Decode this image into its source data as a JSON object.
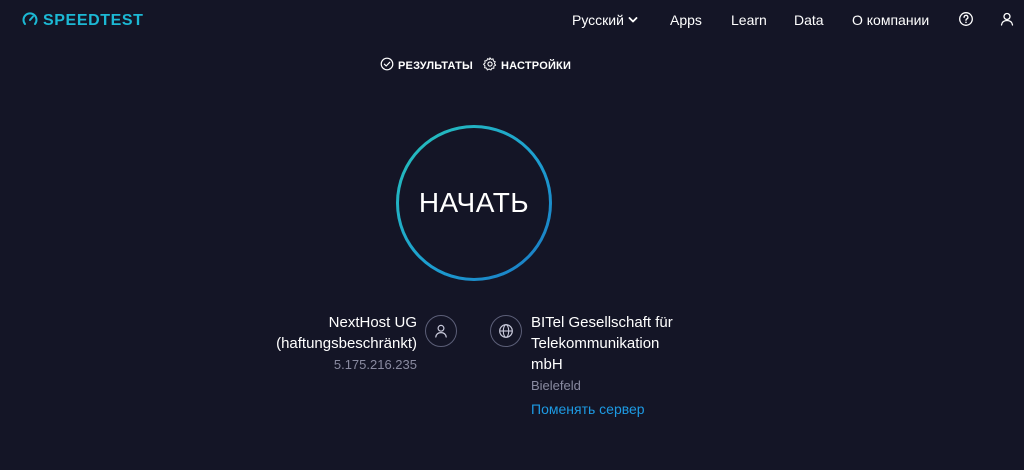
{
  "header": {
    "logo_text": "SPEEDTEST",
    "nav": {
      "language": "Русский",
      "apps": "Apps",
      "learn": "Learn",
      "data": "Data",
      "about": "О компании"
    }
  },
  "subnav": {
    "results": "РЕЗУЛЬТАТЫ",
    "settings": "НАСТРОЙКИ"
  },
  "start_button": "НАЧАТЬ",
  "isp": {
    "name_line1": "NextHost UG",
    "name_line2": "(haftungsbeschränkt)",
    "ip": "5.175.216.235"
  },
  "server": {
    "name_line1": "BITel Gesellschaft für",
    "name_line2": "Telekommunikation",
    "name_line3": "mbH",
    "location": "Bielefeld",
    "change_link": "Поменять сервер"
  },
  "colors": {
    "background": "#141526",
    "accent": "#1cb8d4",
    "link": "#1d9ae3",
    "muted_text": "#898aa0"
  }
}
